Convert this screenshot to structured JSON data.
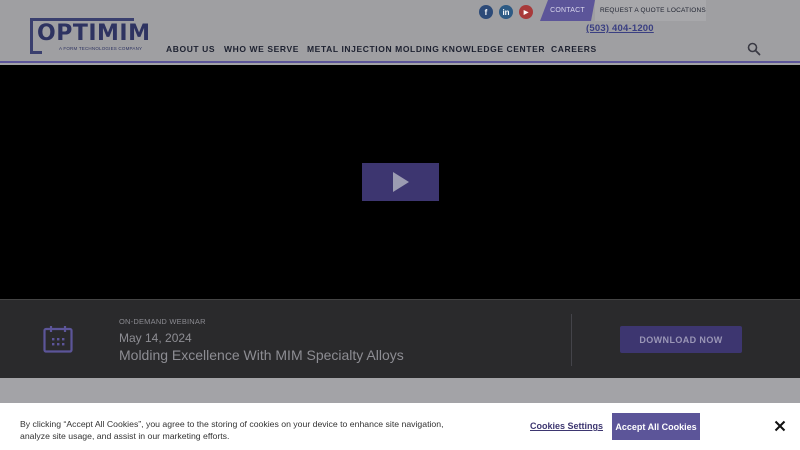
{
  "header": {
    "logo_text": "OPTIMIM",
    "logo_tagline": "A FORM TECHNOLOGIES COMPANY",
    "social": [
      {
        "icon": "facebook-icon",
        "glyph": "f",
        "color": "#2c4a78"
      },
      {
        "icon": "linkedin-icon",
        "glyph": "in",
        "color": "#2d5a84"
      },
      {
        "icon": "youtube-icon",
        "glyph": "▶",
        "color": "#a83a3a"
      }
    ],
    "utility": {
      "contact": "CONTACT",
      "request_quote": "REQUEST A QUOTE",
      "locations": "LOCATIONS"
    },
    "phone": "(503) 404-1200",
    "nav": [
      "ABOUT US",
      "WHO WE SERVE",
      "METAL INJECTION MOLDING",
      "KNOWLEDGE CENTER",
      "CAREERS"
    ],
    "search_icon": "search-icon"
  },
  "video": {
    "play_icon": "play-icon"
  },
  "webinar": {
    "icon": "calendar-icon",
    "kicker": "ON-DEMAND WEBINAR",
    "date": "May 14, 2024",
    "title": "Molding Excellence With MIM Specialty Alloys",
    "download_label": "DOWNLOAD NOW"
  },
  "cookie_banner": {
    "text": "By clicking “Accept All Cookies”, you agree to the storing of cookies on your device to enhance site navigation, analyze site usage, and assist in our marketing efforts.",
    "settings_label": "Cookies Settings",
    "accept_label": "Accept All Cookies",
    "close_icon": "close-icon"
  },
  "colors": {
    "brand_purple": "#5c5599",
    "brand_navy": "#2e3361",
    "accent_dark": "#3d3670"
  }
}
